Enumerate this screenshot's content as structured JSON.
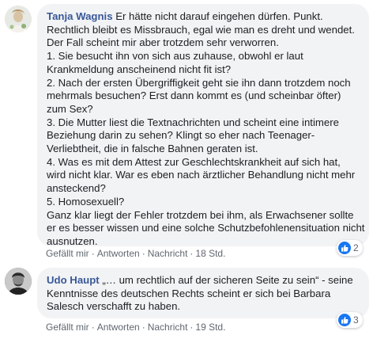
{
  "comments": [
    {
      "author": "Tanja Wagnis",
      "lines": [
        "Er hätte nicht darauf eingehen dürfen. Punkt.",
        "Rechtlich bleibt es Missbrauch, egal wie man es dreht und wendet.",
        "Der Fall scheint mir aber trotzdem sehr verworren.",
        "1. Sie besucht ihn von sich aus zuhause, obwohl er laut",
        "Krankmeldung anscheinend nicht fit ist?",
        "2. Nach der ersten Übergriffigkeit geht sie ihn dann trotzdem noch",
        "mehrmals besuchen? Erst dann kommt es (und scheinbar öfter)",
        "zum Sex?",
        "3. Die Mutter liest die Textnachrichten und scheint eine intimere",
        "Beziehung darin zu sehen? Klingt so eher nach Teenager-",
        "Verliebtheit, die in falsche Bahnen geraten ist.",
        "4. Was es mit dem Attest zur Geschlechtskrankheit auf sich hat,",
        "wird nicht klar. War es eben nach ärztlicher Behandlung nicht mehr",
        "ansteckend?",
        "5. Homosexuell?",
        "Ganz klar liegt der Fehler trotzdem bei ihm, als Erwachsener sollte",
        "er es besser wissen und eine solche Schutzbefohlenensituation nicht",
        "ausnutzen."
      ],
      "actions": {
        "like": "Gefällt mir",
        "reply": "Antworten",
        "message": "Nachricht",
        "time": "18 Std."
      },
      "reaction_count": "2"
    },
    {
      "author": "Udo Haupt",
      "lines": [
        "„… um rechtlich auf der sicheren Seite zu sein“ - seine",
        "Kenntnisse des deutschen Rechts scheint er sich bei Barbara",
        "Salesch verschafft zu haben."
      ],
      "actions": {
        "like": "Gefällt mir",
        "reply": "Antworten",
        "message": "Nachricht",
        "time": "19 Std."
      },
      "reaction_count": "3"
    }
  ],
  "separator": "·",
  "colors": {
    "author": "#385898",
    "bubble": "#f2f3f5",
    "like": "#1877f2",
    "meta": "#606770"
  }
}
